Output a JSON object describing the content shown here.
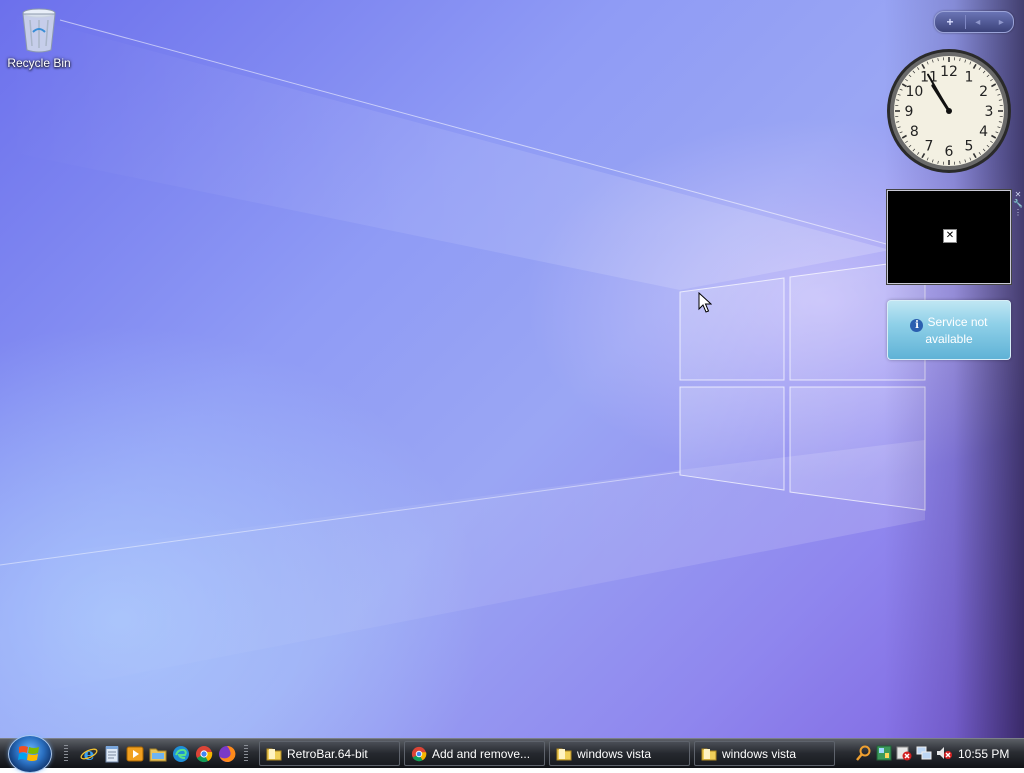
{
  "desktop": {
    "icons": [
      {
        "label": "Recycle Bin",
        "icon": "recycle-bin-icon"
      }
    ]
  },
  "sidebar": {
    "controls": {
      "add": "+",
      "prev": "◂",
      "next": "▸"
    },
    "clock": {
      "numbers": [
        "12",
        "1",
        "2",
        "3",
        "4",
        "5",
        "6",
        "7",
        "8",
        "9",
        "10",
        "11"
      ],
      "time": "10:55"
    },
    "slideshow": {
      "broken_image_glyph": "✕"
    },
    "side_tools": {
      "close": "✕",
      "settings": "🔧"
    },
    "service_gadget": {
      "info_glyph": "i",
      "message": "Service not available"
    }
  },
  "taskbar": {
    "quick_launch": [
      {
        "name": "internet-explorer-icon"
      },
      {
        "name": "notepad-icon"
      },
      {
        "name": "media-player-icon"
      },
      {
        "name": "file-explorer-icon"
      },
      {
        "name": "edge-icon"
      },
      {
        "name": "chrome-icon"
      },
      {
        "name": "firefox-icon"
      }
    ],
    "buttons": [
      {
        "label": "RetroBar.64-bit",
        "icon": "folder-icon"
      },
      {
        "label": "Add and remove...",
        "icon": "chrome-icon"
      },
      {
        "label": "windows vista",
        "icon": "folder-icon"
      },
      {
        "label": "windows vista",
        "icon": "folder-icon"
      }
    ],
    "tray": {
      "icons": [
        "search-icon",
        "network-monitor-icon",
        "security-alert-icon",
        "network-icon",
        "volume-muted-icon"
      ],
      "time": "10:55 PM"
    }
  },
  "colors": {
    "wallpaper_top": "#6c70ec",
    "wallpaper_bottom_left": "#b4d7ff",
    "taskbar": "#2a2d33",
    "service_gadget": "#8fd0e8"
  }
}
